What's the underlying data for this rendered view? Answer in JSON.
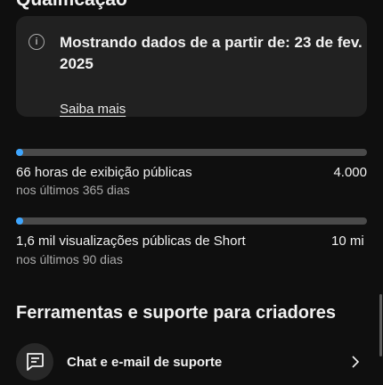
{
  "qualification": {
    "title": "Qualificação",
    "info_text_line1": "Mostrando dados de a partir de: 23 de fev.",
    "info_text_line2": "2025",
    "learn_more": "Saiba mais"
  },
  "metrics": [
    {
      "label": "66 horas de exibição públicas",
      "sub": "nos últimos 365 dias",
      "target": "4.000",
      "progress": 0.0165
    },
    {
      "label": "1,6 mil visualizações públicas de Short",
      "sub": "nos últimos 90 dias",
      "target": "10 mi",
      "progress": 0.00016
    }
  ],
  "tools": {
    "title": "Ferramentas e suporte para criadores",
    "support_label": "Chat e e-mail de suporte"
  },
  "colors": {
    "accent": "#3ea6ff",
    "track": "#4a4a4a",
    "card": "#212121",
    "background": "#0f0f0f"
  }
}
